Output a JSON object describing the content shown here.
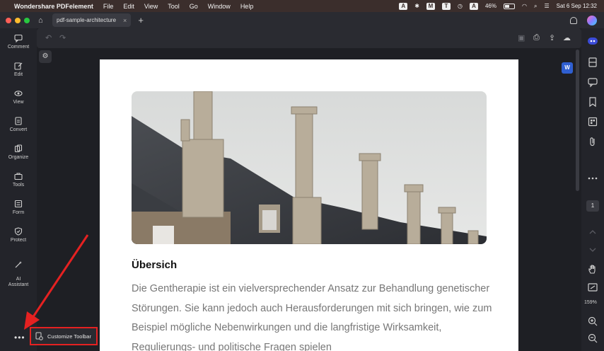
{
  "menubar": {
    "app_name": "Wondershare PDFelement",
    "menus": [
      "File",
      "Edit",
      "View",
      "Tool",
      "Go",
      "Window",
      "Help"
    ],
    "status_icons": [
      "pdfelement-icon",
      "bluetooth-icon",
      "gmail-icon",
      "text-icon",
      "time-machine-icon",
      "a-icon",
      "battery-icon",
      "wifi-icon",
      "search-icon",
      "control-center-icon"
    ],
    "battery": "46%",
    "datetime": "Sat 6 Sep  12:32"
  },
  "tabbar": {
    "tab_label": "pdf-sample-architecture",
    "close_glyph": "×",
    "plus_glyph": "+"
  },
  "left_tools": [
    {
      "label": "Comment",
      "icon": "comment-icon"
    },
    {
      "label": "Edit",
      "icon": "edit-icon"
    },
    {
      "label": "View",
      "icon": "eye-icon"
    },
    {
      "label": "Convert",
      "icon": "convert-icon"
    },
    {
      "label": "Organize",
      "icon": "organize-icon"
    },
    {
      "label": "Tools",
      "icon": "toolbox-icon"
    },
    {
      "label": "Form",
      "icon": "form-icon"
    },
    {
      "label": "Protect",
      "icon": "shield-icon"
    },
    {
      "label": "AI\nAssistant",
      "icon": "ai-icon"
    }
  ],
  "more_label": "•••",
  "customize": {
    "label": "Customize Toolbar",
    "icon": "customize-icon"
  },
  "document": {
    "heading": "Übersich",
    "paragraph": "Die Gentherapie ist ein vielversprechender Ansatz zur Behandlung genetischer Störungen. Sie kann jedoch auch Herausforderungen mit sich bringen, wie zum Beispiel mögliche Nebenwirkungen und die langfristige Wirksamkeit, Regulierungs- und politische Fragen spielen"
  },
  "rightbar": {
    "page_number": "1",
    "zoom": "159%",
    "icons": [
      "ai-chat-icon",
      "panel-icon",
      "comments-icon",
      "bookmark-icon",
      "thumbnails-icon",
      "attachment-icon",
      "more-icon",
      "chevron-up-icon",
      "chevron-down-icon",
      "hand-icon",
      "fit-icon",
      "zoom-in-icon",
      "zoom-out-icon"
    ]
  },
  "colors": {
    "accent_red": "#e52121",
    "word_blue": "#2f5fd1"
  }
}
